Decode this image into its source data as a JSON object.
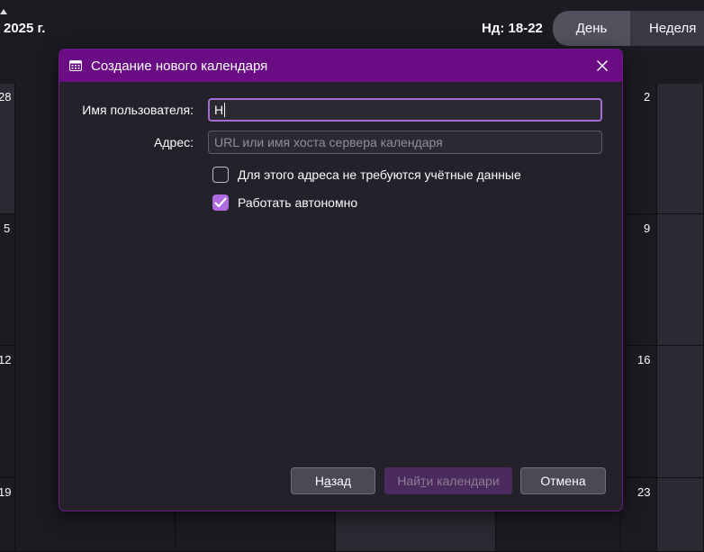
{
  "calendar": {
    "title": "2025 г.",
    "range": "Нд: 18-22",
    "views": {
      "day": "День",
      "week": "Неделя"
    },
    "day_numbers": {
      "row1_left": "28",
      "row1_right": "2",
      "row2_left": "5",
      "row2_right": "9",
      "row3_left": "12",
      "row3_right": "16",
      "row4_left": "19",
      "row4_right": "23"
    }
  },
  "dialog": {
    "title": "Создание нового календаря",
    "icon": "calendar-icon",
    "username_label": "Имя пользователя:",
    "username_value": "Н",
    "address_label": "Адрес:",
    "address_value": "",
    "address_placeholder": "URL или имя хоста сервера календаря",
    "no_credentials_label": "Для этого адреса не требуются учётные данные",
    "no_credentials_checked": false,
    "offline_label": "Работать автономно",
    "offline_checked": true,
    "buttons": {
      "back_prefix": "Н",
      "back_access": "а",
      "back_suffix": "зад",
      "find_prefix": "Най",
      "find_access": "т",
      "find_suffix": "и календари",
      "cancel": "Отмена"
    }
  },
  "colors": {
    "titlebar": "#6a0c84",
    "accent": "#b06ae0",
    "background": "#1c1b22",
    "dialog": "#23222b"
  }
}
